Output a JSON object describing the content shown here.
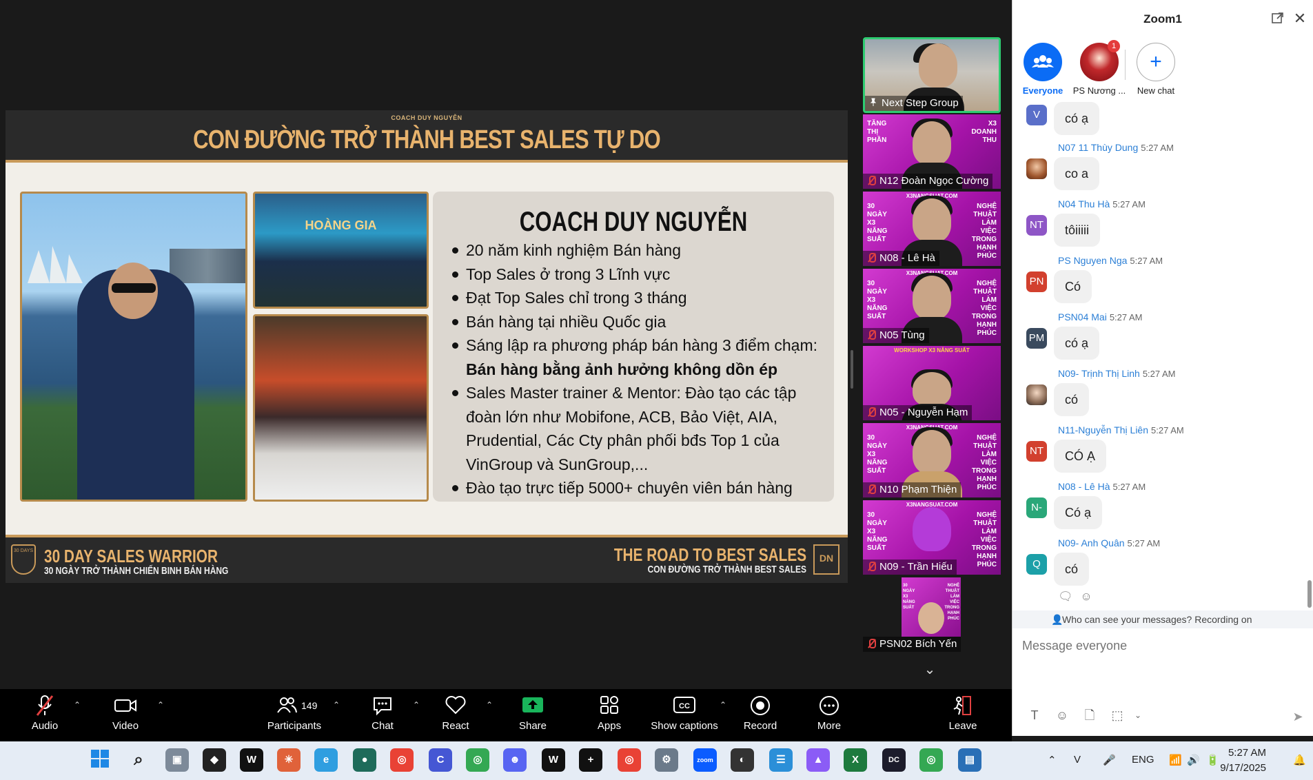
{
  "slide": {
    "header_sub": "COACH DUY NGUYỄN",
    "header_title": "CON ĐƯỜNG TRỞ THÀNH BEST SALES TỰ DO",
    "photo_top_label": "HOÀNG GIA",
    "info_title": "COACH DUY NGUYỄN",
    "bullets": [
      "20 năm kinh nghiệm Bán hàng",
      "Top Sales ở trong 3 Lĩnh vực",
      "Đạt Top Sales chỉ trong 3 tháng",
      "Bán hàng tại nhiều Quốc gia",
      "Sáng lập ra phương pháp bán hàng 3 điểm chạm:",
      "Sales Master trainer & Mentor: Đào tạo các tập đoàn lớn như Mobifone, ACB, Bảo Việt, AIA, Prudential, Các Cty phân phối bđs Top 1 của VinGroup và SunGroup,...",
      "Đào tạo trực tiếp 5000+ chuyên viên bán hàng"
    ],
    "bullet_bold": "Bán hàng bằng ảnh hưởng không dồn ép",
    "footer_left_badge": "30 DAYS",
    "footer_left_title": "30 DAY SALES WARRIOR",
    "footer_left_sub": "30 NGÀY TRỞ THÀNH CHIẾN BINH BÁN HÀNG",
    "footer_right_title": "THE ROAD TO BEST SALES",
    "footer_right_sub": "CON ĐƯỜNG TRỞ THÀNH BEST SALES",
    "footer_right_logo": "DN"
  },
  "tiles": [
    {
      "name": "Next Step Group",
      "muted": false
    },
    {
      "name": "N12 Đoàn Ngọc Cường",
      "muted": true,
      "left": "TĂNG THỊ PHẦN",
      "right": "X3 DOANH THU"
    },
    {
      "name": "N08 - Lê Hà",
      "muted": true,
      "site": "X3NANGSUAT.COM",
      "left": "30 NGÀY X3 NĂNG SUẤT",
      "right": "NGHỆ THUẬT LÀM VIỆC TRONG HẠNH PHÚC"
    },
    {
      "name": "N05 Tùng",
      "muted": true,
      "site": "X3NANGSUAT.COM",
      "left": "30 NGÀY X3 NĂNG SUẤT",
      "right": "NGHỆ THUẬT LÀM VIỆC TRONG HẠNH PHÚC"
    },
    {
      "name": "N05 - Nguyễn Hạm",
      "muted": true,
      "site": "WORKSHOP X3 NĂNG SUẤT",
      "left": "",
      "right": ""
    },
    {
      "name": "N10 Phạm Thiện",
      "muted": true,
      "site": "X3NANGSUAT.COM",
      "left": "30 NGÀY X3 NĂNG SUẤT",
      "right": "NGHỆ THUẬT LÀM VIỆC TRONG HẠNH PHÚC"
    },
    {
      "name": "N09 - Trần Hiếu",
      "muted": true,
      "site": "X3NANGSUAT.COM",
      "left": "30 NGÀY X3 NĂNG SUẤT",
      "right": "NGHỆ THUẬT LÀM VIỆC TRONG HẠNH PHÚC"
    },
    {
      "name": "PSN02 Bích Yến",
      "muted": true,
      "site": "",
      "left": "30 NGÀY X3 NĂNG SUẤT",
      "right": "NGHỆ THUẬT LÀM VIỆC TRONG HẠNH PHÚC"
    }
  ],
  "chat": {
    "title": "Zoom1",
    "recipients": {
      "everyone": "Everyone",
      "ps": "PS Nương ...",
      "ps_badge": "1",
      "new": "New chat"
    },
    "messages": [
      {
        "who": "",
        "time": "",
        "initials": "V",
        "color": "#5a6fc9",
        "text": "có ạ"
      },
      {
        "who": "N07 11 Thùy Dung",
        "time": "5:27 AM",
        "initials": "",
        "color": "",
        "text": "co a"
      },
      {
        "who": "N04 Thu Hà",
        "time": "5:27 AM",
        "initials": "NT",
        "color": "#8e56c6",
        "text": "tôiiiii"
      },
      {
        "who": "PS Nguyen Nga",
        "time": "5:27 AM",
        "initials": "PN",
        "color": "#d2402e",
        "text": "Có"
      },
      {
        "who": "PSN04 Mai",
        "time": "5:27 AM",
        "initials": "PM",
        "color": "#3a4a5e",
        "text": "có ạ"
      },
      {
        "who": "N09- Trịnh Thị Linh",
        "time": "5:27 AM",
        "initials": "",
        "color": "",
        "text": "có"
      },
      {
        "who": "N11-Nguyễn Thị Liên",
        "time": "5:27 AM",
        "initials": "NT",
        "color": "#d2402e",
        "text": "CÓ Ạ"
      },
      {
        "who": "N08 - Lê Hà",
        "time": "5:27 AM",
        "initials": "N-",
        "color": "#2aa779",
        "text": "Có ạ"
      },
      {
        "who": "N09- Anh Quân",
        "time": "5:27 AM",
        "initials": "Q",
        "color": "#1ca0a8",
        "text": "có"
      }
    ],
    "visibility": "Who can see your messages? Recording on",
    "input_placeholder": "Message everyone"
  },
  "toolbar": {
    "audio": "Audio",
    "video": "Video",
    "participants": "Participants",
    "participants_count": "149",
    "chat": "Chat",
    "react": "React",
    "share": "Share",
    "apps": "Apps",
    "captions": "Show captions",
    "record": "Record",
    "more": "More",
    "leave": "Leave"
  },
  "taskbar": {
    "lang": "ENG",
    "time": "5:27 AM",
    "date": "9/17/2025"
  }
}
